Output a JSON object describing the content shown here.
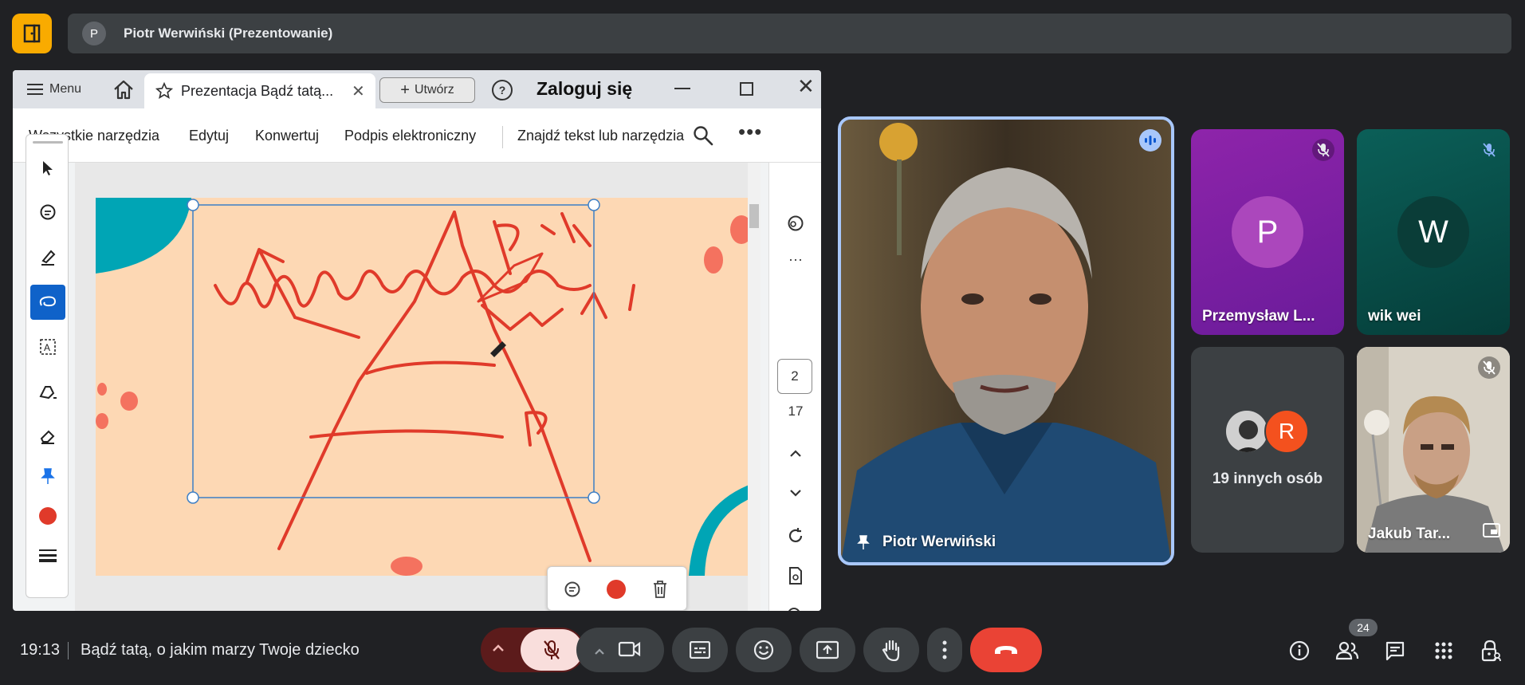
{
  "top_bar": {
    "presenter_initial": "P",
    "presenter_label": "Piotr Werwiński (Prezentowanie)"
  },
  "shared_window": {
    "menu_label": "Menu",
    "tab_title": "Prezentacja Bądź tatą...",
    "create_label": "Utwórz",
    "login_label": "Zaloguj się",
    "toolbar": {
      "all_tools": "Wszystkie narzędzia",
      "edit": "Edytuj",
      "convert": "Konwertuj",
      "esign": "Podpis elektroniczny",
      "find": "Znajdź tekst lub narzędzia"
    },
    "page_current": "2",
    "page_total": "17",
    "pen_color": "#e03a2a"
  },
  "participants": {
    "main": {
      "name": "Piotr Werwiński"
    },
    "p_tile": {
      "initial": "P",
      "name": "Przemysław L...",
      "color": "#a53fc0"
    },
    "w_tile": {
      "initial": "W",
      "name": "wik wei",
      "color": "#0a4a43"
    },
    "others": {
      "avatar_initial": "R",
      "label": "19 innych osób",
      "avatar_color": "#f4511e"
    },
    "j_tile": {
      "name": "Jakub Tar..."
    }
  },
  "bottom_bar": {
    "time": "19:13",
    "meeting_title": "Bądź tatą, o jakim marzy Twoje dziecko",
    "people_count": "24",
    "end_call_color": "#ea4335"
  }
}
